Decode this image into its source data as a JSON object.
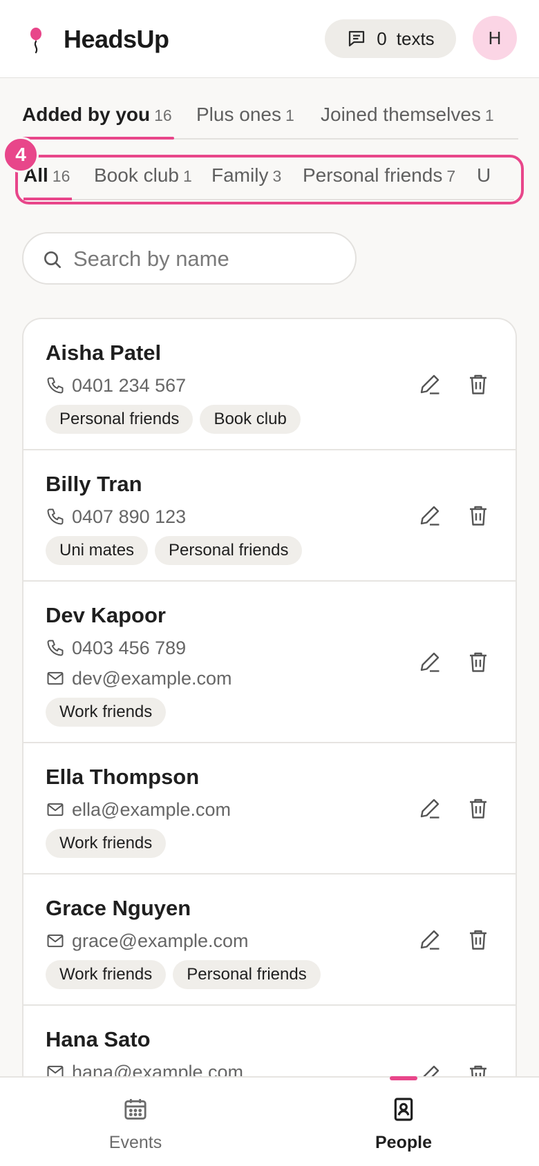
{
  "app": {
    "name": "HeadsUp",
    "texts_count": "0",
    "texts_label": "texts",
    "avatar_initial": "H"
  },
  "primary_tabs": [
    {
      "label": "Added by you",
      "count": "16",
      "active": true
    },
    {
      "label": "Plus ones",
      "count": "1",
      "active": false
    },
    {
      "label": "Joined themselves",
      "count": "1",
      "active": false
    }
  ],
  "group_tabs": [
    {
      "label": "All",
      "count": "16",
      "active": true
    },
    {
      "label": "Book club",
      "count": "1",
      "active": false
    },
    {
      "label": "Family",
      "count": "3",
      "active": false
    },
    {
      "label": "Personal friends",
      "count": "7",
      "active": false
    },
    {
      "label": "U",
      "count": "",
      "active": false
    }
  ],
  "step_badge": "4",
  "search": {
    "placeholder": "Search by name",
    "value": ""
  },
  "people": [
    {
      "name": "Aisha Patel",
      "phone": "0401 234 567",
      "email": "",
      "tags": [
        "Personal friends",
        "Book club"
      ]
    },
    {
      "name": "Billy Tran",
      "phone": "0407 890 123",
      "email": "",
      "tags": [
        "Uni mates",
        "Personal friends"
      ]
    },
    {
      "name": "Dev Kapoor",
      "phone": "0403 456 789",
      "email": "dev@example.com",
      "tags": [
        "Work friends"
      ]
    },
    {
      "name": "Ella Thompson",
      "phone": "",
      "email": "ella@example.com",
      "tags": [
        "Work friends"
      ]
    },
    {
      "name": "Grace Nguyen",
      "phone": "",
      "email": "grace@example.com",
      "tags": [
        "Work friends",
        "Personal friends"
      ]
    },
    {
      "name": "Hana Sato",
      "phone": "",
      "email": "hana@example.com",
      "tags": []
    }
  ],
  "bottom_nav": [
    {
      "label": "Events",
      "icon": "calendar-icon",
      "active": false
    },
    {
      "label": "People",
      "icon": "contacts-book-icon",
      "active": true
    }
  ],
  "colors": {
    "accent": "#e8468a",
    "avatar_bg": "#fbd5e5",
    "pill_bg": "#eeece8",
    "page_bg": "#f9f8f6"
  }
}
